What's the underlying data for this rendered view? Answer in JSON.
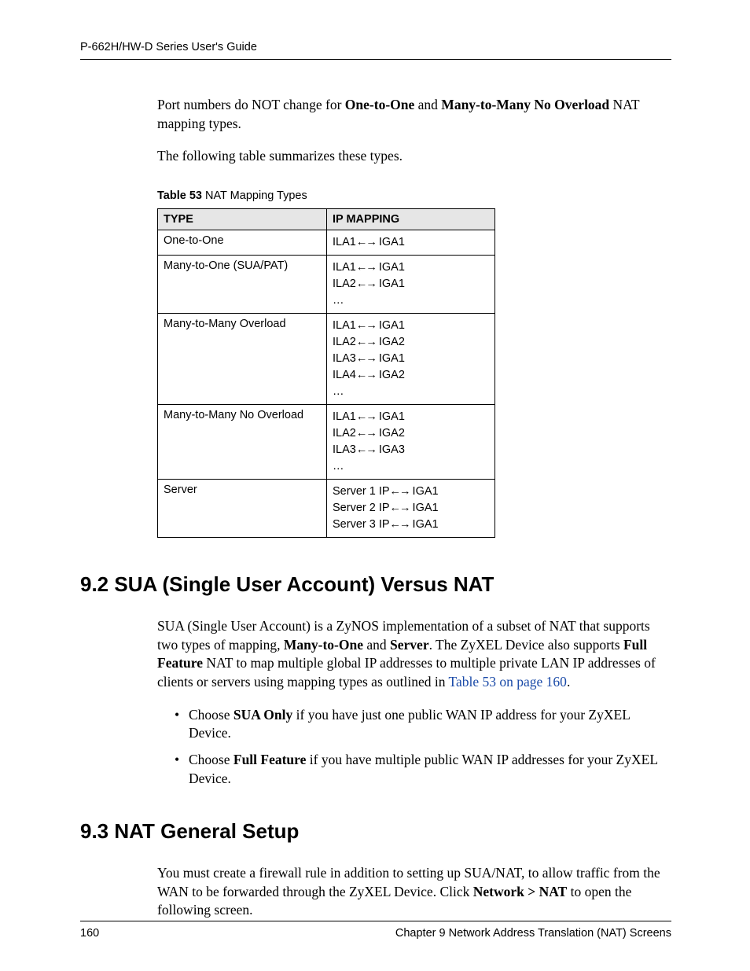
{
  "header": {
    "title": "P-662H/HW-D Series User's Guide"
  },
  "intro": {
    "p1_pre": "Port numbers do NOT change for ",
    "p1_b1": "One-to-One",
    "p1_mid": " and ",
    "p1_b2": "Many-to-Many No Overload",
    "p1_post": " NAT mapping types.",
    "p2": "The following table summarizes these types."
  },
  "table": {
    "caption_strong": "Table 53",
    "caption_rest": "   NAT Mapping Types",
    "col1": "TYPE",
    "col2": "IP MAPPING",
    "arrow": "←→",
    "ellipsis": "…",
    "rows": [
      {
        "type": "One-to-One",
        "maps": [
          [
            "ILA1",
            " IGA1"
          ]
        ]
      },
      {
        "type": "Many-to-One (SUA/PAT)",
        "maps": [
          [
            "ILA1",
            " IGA1"
          ],
          [
            "ILA2",
            " IGA1"
          ]
        ],
        "ell": true
      },
      {
        "type": "Many-to-Many Overload",
        "maps": [
          [
            "ILA1",
            " IGA1"
          ],
          [
            "ILA2",
            " IGA2"
          ],
          [
            "ILA3",
            " IGA1"
          ],
          [
            "ILA4",
            " IGA2"
          ]
        ],
        "ell": true
      },
      {
        "type": "Many-to-Many No Overload",
        "maps": [
          [
            "ILA1",
            " IGA1"
          ],
          [
            "ILA2",
            " IGA2"
          ],
          [
            "ILA3",
            " IGA3"
          ]
        ],
        "ell": true
      },
      {
        "type": "Server",
        "maps": [
          [
            "Server 1 IP",
            " IGA1"
          ],
          [
            "Server 2 IP",
            " IGA1"
          ],
          [
            "Server 3 IP",
            " IGA1"
          ]
        ]
      }
    ]
  },
  "sec92": {
    "heading": "9.2  SUA (Single User Account) Versus NAT",
    "p_pre": "SUA (Single User Account) is a ZyNOS implementation of a subset of NAT that supports two types of mapping, ",
    "b1": "Many-to-One",
    "mid1": " and ",
    "b2": "Server",
    "mid2": ". The ZyXEL Device also supports ",
    "b3": "Full Feature",
    "post1": " NAT to map multiple global IP addresses to multiple private LAN IP addresses of clients or servers using mapping types as outlined in ",
    "link": "Table 53 on page 160",
    "post2": ".",
    "bul1_pre": "Choose ",
    "bul1_b": "SUA Only",
    "bul1_post": " if you have just one public WAN IP address for your ZyXEL Device.",
    "bul2_pre": "Choose ",
    "bul2_b": "Full Feature",
    "bul2_post": " if you have multiple public WAN IP addresses for your ZyXEL Device."
  },
  "sec93": {
    "heading": "9.3  NAT General Setup",
    "p_pre": "You must create a firewall rule in addition to setting up SUA/NAT, to allow traffic from the WAN to be forwarded through the ZyXEL Device. Click ",
    "b": "Network > NAT",
    "post": " to open the following screen."
  },
  "footer": {
    "pagenum": "160",
    "chapter": "Chapter 9 Network Address Translation (NAT) Screens"
  }
}
